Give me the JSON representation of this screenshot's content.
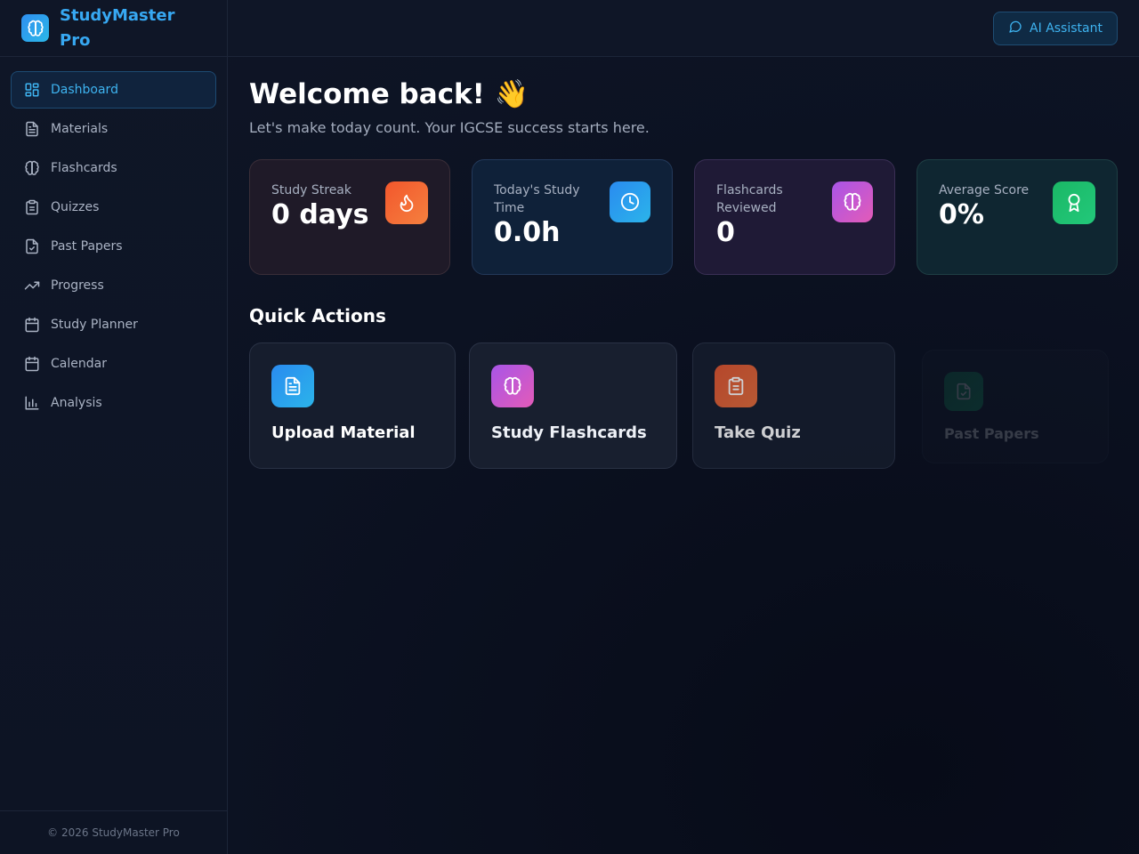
{
  "brand": {
    "name": "StudyMaster Pro",
    "accent": "#37a8f2"
  },
  "topbar": {
    "ai_button": "AI Assistant"
  },
  "sidebar": {
    "items": [
      {
        "label": "Dashboard",
        "icon": "dashboard-icon",
        "active": true
      },
      {
        "label": "Materials",
        "icon": "document-icon"
      },
      {
        "label": "Flashcards",
        "icon": "brain-icon"
      },
      {
        "label": "Quizzes",
        "icon": "clipboard-icon"
      },
      {
        "label": "Past Papers",
        "icon": "file-check-icon"
      },
      {
        "label": "Progress",
        "icon": "trending-up-icon"
      },
      {
        "label": "Study Planner",
        "icon": "calendar-icon"
      },
      {
        "label": "Calendar",
        "icon": "calendar-icon"
      },
      {
        "label": "Analysis",
        "icon": "bar-chart-icon"
      }
    ],
    "footer": "© 2026 StudyMaster Pro"
  },
  "main": {
    "welcome": "Welcome back! 👋",
    "subtitle": "Let's make today count. Your IGCSE success starts here.",
    "stats": [
      {
        "label": "Study Streak",
        "value": "0 days",
        "icon": "flame-icon",
        "color": "#f26a36"
      },
      {
        "label": "Today's Study Time",
        "value": "0.0h",
        "icon": "clock-icon",
        "color": "#2e9df0"
      },
      {
        "label": "Flashcards Reviewed",
        "value": "0",
        "icon": "brain-icon",
        "color": "#c65ad8"
      },
      {
        "label": "Average Score",
        "value": "0%",
        "icon": "award-icon",
        "color": "#1fc06b"
      }
    ],
    "quick_actions_title": "Quick Actions",
    "quick_actions": [
      {
        "label": "Upload Material",
        "icon": "document-icon"
      },
      {
        "label": "Study Flashcards",
        "icon": "brain-icon"
      },
      {
        "label": "Take Quiz",
        "icon": "clipboard-icon"
      },
      {
        "label": "Past Papers",
        "icon": "file-check-icon"
      }
    ]
  }
}
